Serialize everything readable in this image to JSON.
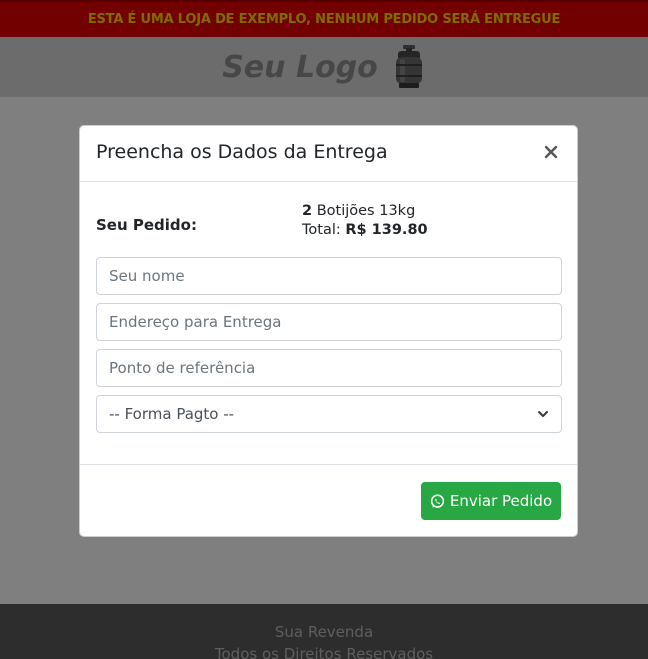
{
  "banner": {
    "text": "ESTA É UMA LOJA DE EXEMPLO, NENHUM PEDIDO SERÁ ENTREGUE"
  },
  "header": {
    "logo_text": "Seu Logo",
    "logo_icon": "gas-cylinder-icon"
  },
  "footer": {
    "line1": "Sua Revenda",
    "line2": "Todos os Direitos Reservados"
  },
  "modal": {
    "title": "Preencha os Dados da Entrega",
    "close_icon": "close-icon",
    "order": {
      "label": "Seu Pedido:",
      "quantity": "2",
      "product": "Botijões 13kg",
      "total_label": "Total:",
      "total_value": "R$ 139.80"
    },
    "fields": {
      "name_placeholder": "Seu nome",
      "address_placeholder": "Endereço para Entrega",
      "reference_placeholder": "Ponto de referência",
      "payment_selected": "-- Forma Pagto --"
    },
    "submit": {
      "label": "Enviar Pedido",
      "icon": "whatsapp-icon"
    }
  },
  "colors": {
    "banner_bg": "#e60000",
    "banner_text": "#ffd600",
    "button_bg": "#28a745"
  }
}
